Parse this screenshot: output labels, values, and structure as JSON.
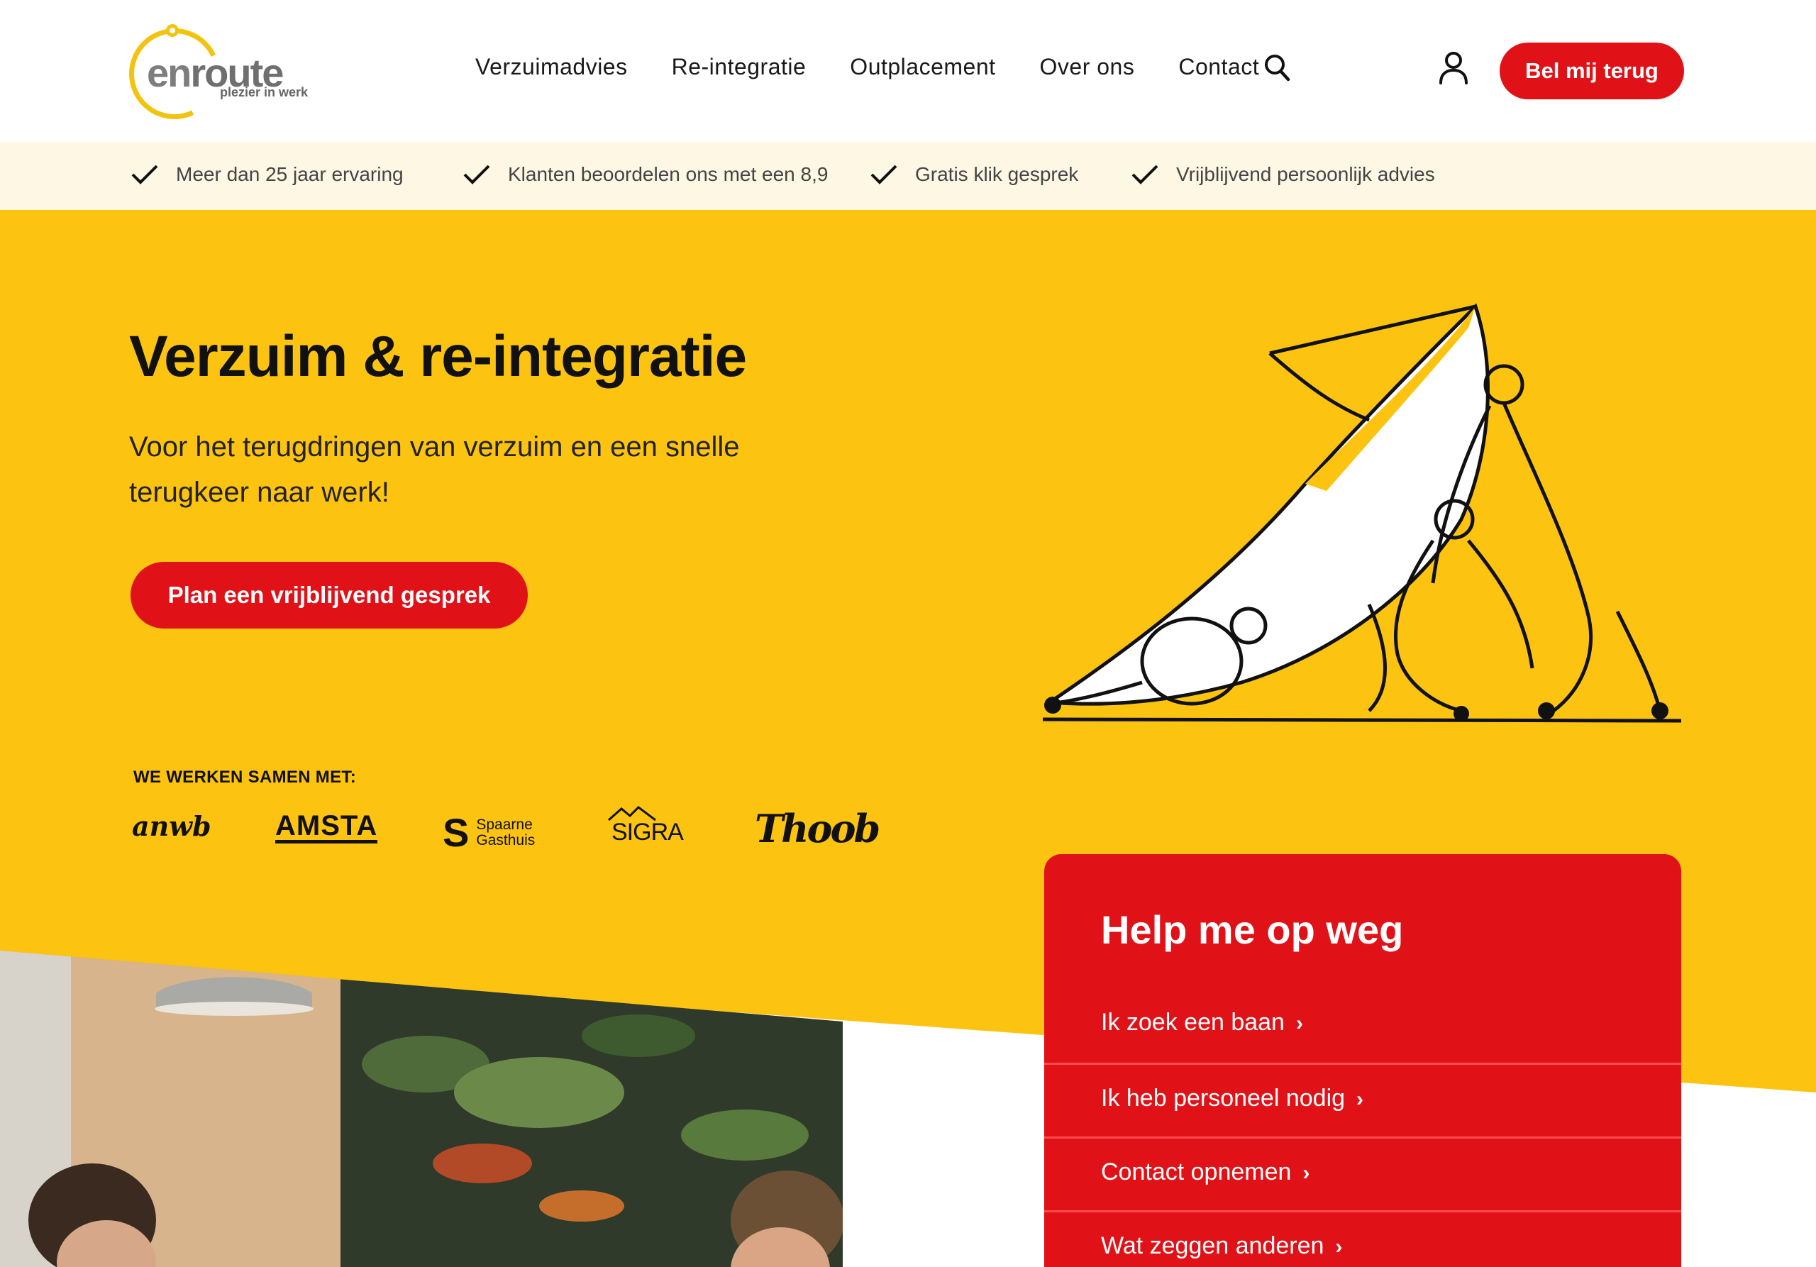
{
  "brand": {
    "logo_word_en": "en",
    "logo_word_route": "route",
    "logo_tagline": "plezier in werk",
    "colors": {
      "yellow": "#FCC310",
      "red": "#E01218",
      "cream": "#FDF7E4"
    }
  },
  "nav": {
    "items": [
      "Verzuimadvies",
      "Re-integratie",
      "Outplacement",
      "Over ons",
      "Contact"
    ],
    "search_icon": "search-icon",
    "user_icon": "user-icon",
    "cta": "Bel mij terug"
  },
  "usps": [
    "Meer dan 25 jaar ervaring",
    "Klanten beoordelen ons met een 8,9",
    "Gratis klik gesprek",
    "Vrijblijvend persoonlijk advies"
  ],
  "hero": {
    "title": "Verzuim & re-integratie",
    "subtitle": "Voor het terugdringen van verzuim en een snelle terugkeer naar werk!",
    "cta": "Plan een vrijblijvend gesprek"
  },
  "partners": {
    "label": "WE WERKEN SAMEN MET:",
    "anwb": "anwb",
    "amsta": "AMSTA",
    "spaarne_mark": "S",
    "spaarne_line1": "Spaarne",
    "spaarne_line2": "Gasthuis",
    "sigra": "SIGRA",
    "thoob": "Thoob"
  },
  "help": {
    "title": "Help me op weg",
    "items": [
      "Ik zoek een baan",
      "Ik heb personeel nodig",
      "Contact opnemen",
      "Wat zeggen anderen"
    ]
  }
}
